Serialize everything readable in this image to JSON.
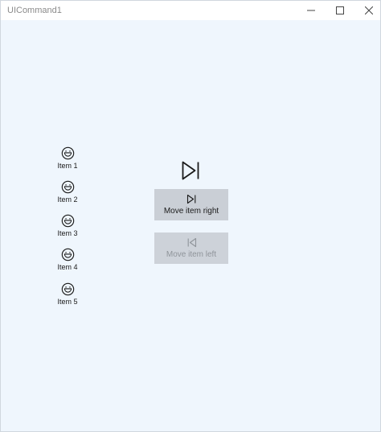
{
  "window": {
    "title": "UICommand1"
  },
  "items": [
    {
      "label": "Item 1",
      "icon": "smiley-icon"
    },
    {
      "label": "Item 2",
      "icon": "smiley-icon"
    },
    {
      "label": "Item 3",
      "icon": "smiley-icon"
    },
    {
      "label": "Item 4",
      "icon": "smiley-icon"
    },
    {
      "label": "Item 5",
      "icon": "smiley-icon"
    }
  ],
  "commands": {
    "move_right": {
      "label": "Move item right",
      "icon": "next-track-icon",
      "enabled": true
    },
    "move_left": {
      "label": "Move item left",
      "icon": "previous-track-icon",
      "enabled": false
    }
  },
  "colors": {
    "background": "#eff6fd",
    "button": "#cacfd6",
    "disabled_text": "#8f949a"
  }
}
